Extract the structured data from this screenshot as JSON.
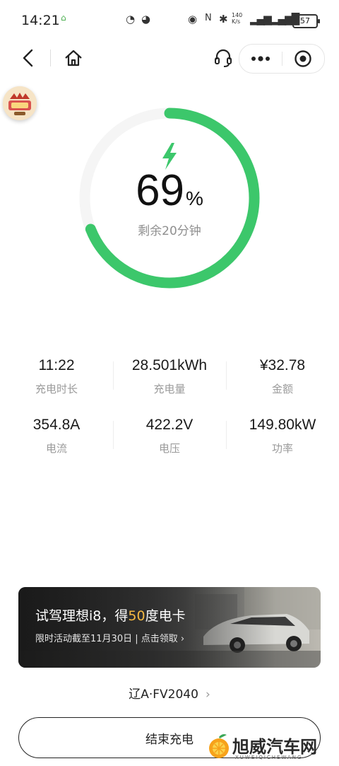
{
  "status_bar": {
    "time": "14:21",
    "network_speed": "140\nK/s",
    "battery": "57"
  },
  "charging": {
    "percent": "69",
    "percent_unit": "%",
    "progress_fraction": 0.69,
    "remaining": "剩余20分钟",
    "accent_color": "#3cc76b"
  },
  "stats": [
    {
      "value": "11:22",
      "label": "充电时长"
    },
    {
      "value": "28.501kWh",
      "label": "充电量"
    },
    {
      "value": "¥32.78",
      "label": "金额"
    },
    {
      "value": "354.8A",
      "label": "电流"
    },
    {
      "value": "422.2V",
      "label": "电压"
    },
    {
      "value": "149.80kW",
      "label": "功率"
    }
  ],
  "banner": {
    "title_pre": "试驾理想i8，得",
    "title_highlight": "50",
    "title_post": "度电卡",
    "subtitle": "限时活动截至11月30日 | 点击领取 ›"
  },
  "plate": "辽A·FV2040",
  "plate_chevron": "›",
  "end_button": "结束充电",
  "watermark": {
    "title": "旭威汽车网",
    "sub": "XUWEIQICHEWANG"
  },
  "icons": [
    "back-icon",
    "home-icon",
    "headset-icon",
    "more-icon",
    "target-icon",
    "bolt-icon"
  ]
}
